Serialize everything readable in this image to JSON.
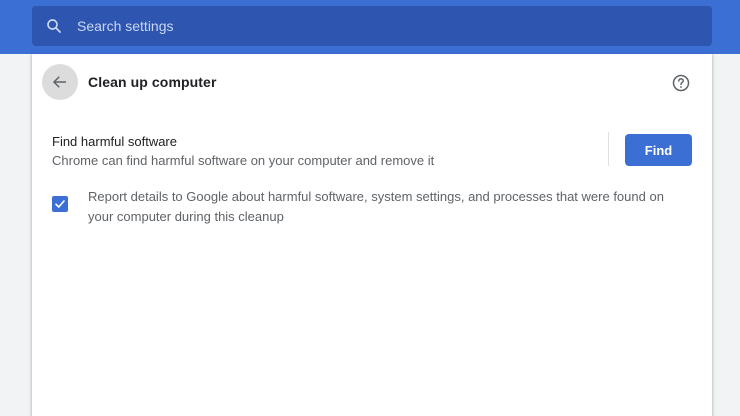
{
  "search": {
    "placeholder": "Search settings",
    "icon": "search-icon"
  },
  "header": {
    "back_icon": "arrow-back-icon",
    "title": "Clean up computer",
    "help_icon": "help-icon"
  },
  "find_section": {
    "title": "Find harmful software",
    "description": "Chrome can find harmful software on your computer and remove it",
    "button_label": "Find"
  },
  "report": {
    "checked": true,
    "text": "Report details to Google about harmful software, system settings, and processes that were found on your computer during this cleanup"
  },
  "colors": {
    "accent": "#3b6fd4",
    "search_bg": "#2e56b0",
    "page_bg": "#f1f3f4"
  }
}
